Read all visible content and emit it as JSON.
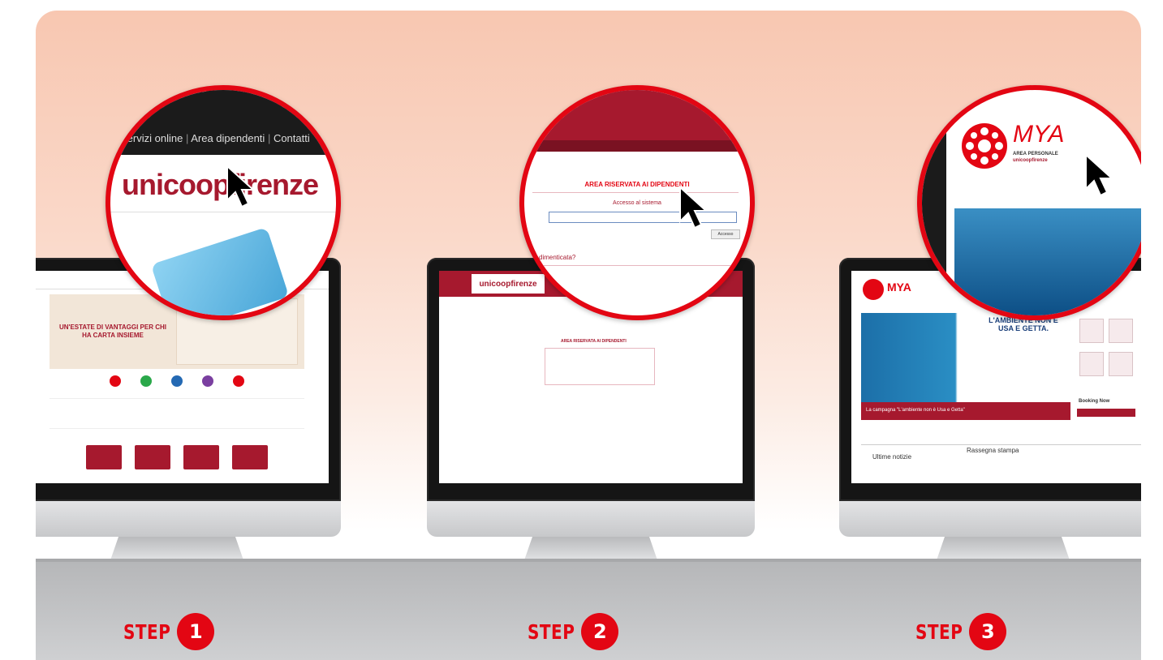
{
  "steps": [
    {
      "word": "STEP",
      "number": "1"
    },
    {
      "word": "STEP",
      "number": "2"
    },
    {
      "word": "STEP",
      "number": "3"
    }
  ],
  "zoom1": {
    "nav": [
      "Servizi online",
      "Area dipendenti",
      "Contatti"
    ],
    "logo_a": "unicoop",
    "logo_b": "firenze"
  },
  "zoom2": {
    "area_title": "AREA RISERVATA AI DIPENDENTI",
    "form_title": "Accesso al sistema",
    "forgot": "dimenticata?",
    "button": "Accesso"
  },
  "zoom3": {
    "brand": "MYA",
    "tag1": "AREA PERSONALE",
    "tag2": "unicoopfirenze"
  },
  "screen1": {
    "logo": "unicoopfirenze",
    "banner": "UN'ESTATE DI VANTAGGI PER CHI HA CARTA INSIEME"
  },
  "screen2": {
    "logo": "unicoopfirenze",
    "title": "AREA RISERVATA AI DIPENDENTI"
  },
  "screen3": {
    "brand": "MYA",
    "hero": "L'AMBIENTE NON È USA E GETTA.",
    "caption": "La campagna \"L'ambiente non è Usa e Getta\"",
    "tab_left": "Ultime notizie",
    "tab_right": "Rassegna stampa",
    "side_label": "Booking Now"
  },
  "colors": {
    "accent": "#e30613",
    "brand": "#a6192e"
  }
}
